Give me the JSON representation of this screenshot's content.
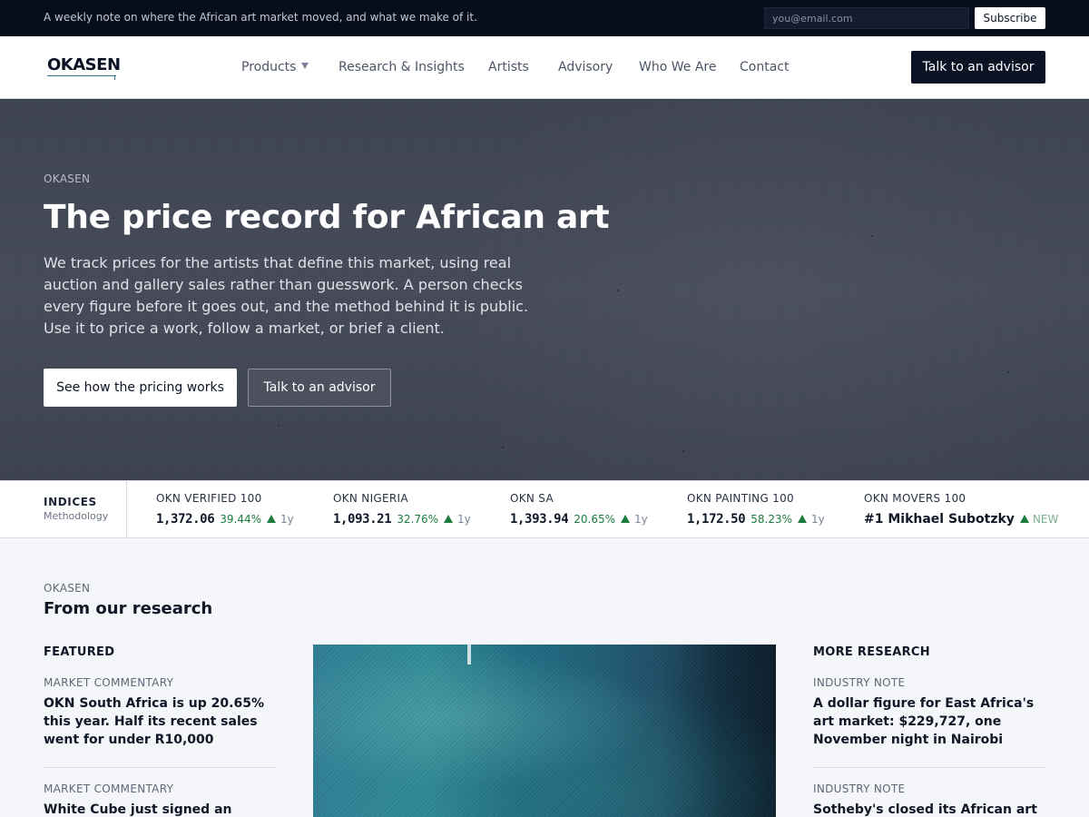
{
  "topbar": {
    "note": "A weekly note on where the African art market moved, and what we make of it.",
    "email_placeholder": "you@email.com",
    "subscribe_label": "Subscribe"
  },
  "nav": {
    "logo": "OKASEN",
    "links": [
      "Products",
      "Research & Insights",
      "Artists",
      "Advisory",
      "Who We Are",
      "Contact"
    ],
    "products_caret_icon": "caret-down-icon",
    "cta_label": "Talk to an advisor"
  },
  "hero": {
    "eyebrow": "OKASEN",
    "title": "The price record for African art",
    "body": "We track prices for the artists that define this market, using real auction and gallery sales rather than guesswork. A person checks every figure before it goes out, and the method behind it is public. Use it to price a work, follow a market, or brief a client.",
    "primary_label": "See how the pricing works",
    "secondary_label": "Talk to an advisor"
  },
  "indices": {
    "title": "INDICES",
    "methodology": "Methodology",
    "up_color": "#1b7a3c",
    "up_icon": "arrow-up-triangle-icon",
    "items": [
      {
        "name": "OKN VERIFIED 100",
        "value": "1,372.06",
        "change": "39.44%",
        "period": "1y"
      },
      {
        "name": "OKN NIGERIA",
        "value": "1,093.21",
        "change": "32.76%",
        "period": "1y"
      },
      {
        "name": "OKN SA",
        "value": "1,393.94",
        "change": "20.65%",
        "period": "1y"
      },
      {
        "name": "OKN PAINTING 100",
        "value": "1,172.50",
        "change": "58.23%",
        "period": "1y"
      }
    ],
    "movers": {
      "name": "OKN MOVERS 100",
      "value": "#1 Mikhael Subotzky",
      "badge": "NEW"
    }
  },
  "research": {
    "eyebrow": "OKASEN",
    "title": "From our research",
    "featured": {
      "heading": "FEATURED",
      "items": [
        {
          "category": "MARKET COMMENTARY",
          "headline": "OKN South Africa is up 20.65% this year. Half its recent sales went for under R10,000"
        },
        {
          "category": "MARKET COMMENTARY",
          "headline": "White Cube just signed an Ethiopian"
        }
      ]
    },
    "more": {
      "heading": "MORE RESEARCH",
      "items": [
        {
          "category": "INDUSTRY NOTE",
          "headline": "A dollar figure for East Africa's art market: $229,727, one November night in Nairobi"
        },
        {
          "category": "INDUSTRY NOTE",
          "headline": "Sotheby's closed its African art"
        }
      ]
    }
  }
}
